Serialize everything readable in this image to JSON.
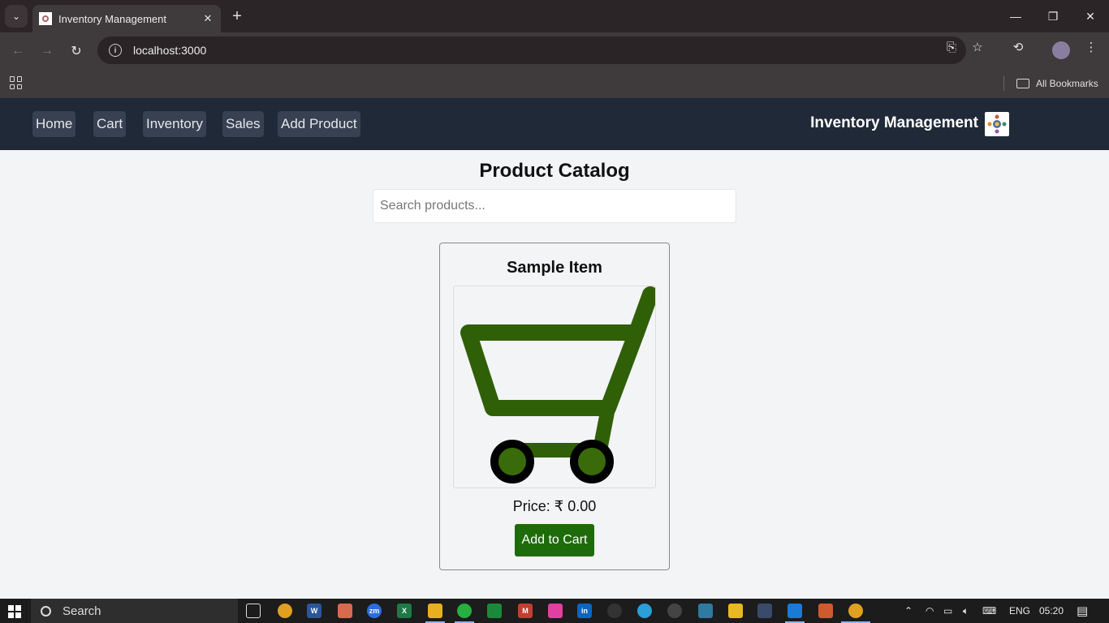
{
  "browser": {
    "tab_title": "Inventory Management",
    "url": "localhost:3000",
    "bookmarks_label": "All Bookmarks"
  },
  "nav": {
    "links": [
      "Home",
      "Cart",
      "Inventory",
      "Sales",
      "Add Product"
    ],
    "brand": "Inventory Management"
  },
  "main": {
    "title": "Product Catalog",
    "search_placeholder": "Search products...",
    "products": [
      {
        "name": "Sample Item",
        "price": "Price: ₹ 0.00",
        "button": "Add to Cart",
        "image_icon": "shopping-cart-icon"
      }
    ]
  },
  "taskbar": {
    "search_label": "Search",
    "language": "ENG",
    "time": "05:20"
  },
  "colors": {
    "nav_bg": "#1f2937",
    "nav_link_bg": "#374151",
    "button_green": "#1e6b0a",
    "cart_green": "#2f5f07",
    "page_bg": "#f3f4f6"
  }
}
